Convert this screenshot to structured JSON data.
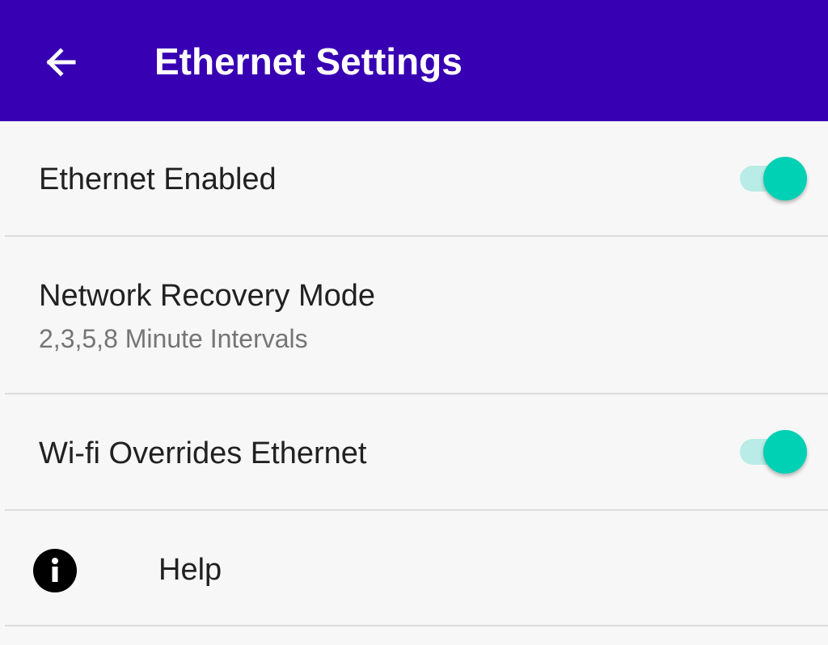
{
  "app_bar": {
    "title": "Ethernet Settings",
    "back_icon": "arrow-left-icon",
    "background": "#3700b3"
  },
  "settings": {
    "ethernet_enabled": {
      "label": "Ethernet Enabled",
      "toggle_on": true
    },
    "network_recovery": {
      "label": "Network Recovery Mode",
      "summary": "2,3,5,8 Minute Intervals"
    },
    "wifi_override": {
      "label": "Wi-fi Overrides Ethernet",
      "toggle_on": true
    },
    "help": {
      "label": "Help",
      "icon": "info-icon"
    }
  },
  "colors": {
    "accent": "#00d0b4",
    "accent_track": "#b9ece6"
  }
}
